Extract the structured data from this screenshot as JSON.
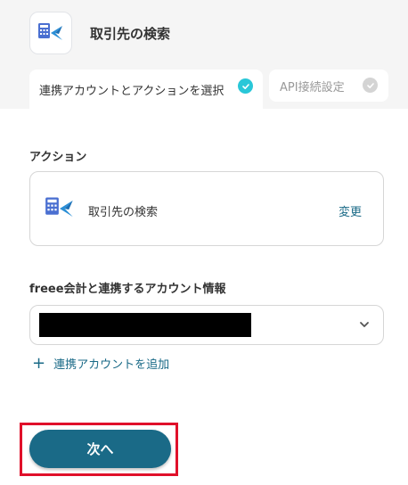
{
  "header": {
    "title": "取引先の検索",
    "app_icon": "freee-accounting-icon"
  },
  "tabs": [
    {
      "label": "連携アカウントとアクションを選択",
      "state": "completed",
      "status_color": "#29c7d8"
    },
    {
      "label": "API接続設定",
      "state": "pending",
      "status_color": "#d4d4d4"
    }
  ],
  "action_section": {
    "label": "アクション",
    "card_label": "取引先の検索",
    "change_label": "変更"
  },
  "account_section": {
    "label": "freee会計と連携するアカウント情報",
    "selected_value": "[redacted]",
    "add_label": "連携アカウントを追加"
  },
  "footer": {
    "next_label": "次へ"
  },
  "colors": {
    "accent": "#1a6a87",
    "check_active": "#29c7d8",
    "highlight_border": "#e0102a"
  }
}
